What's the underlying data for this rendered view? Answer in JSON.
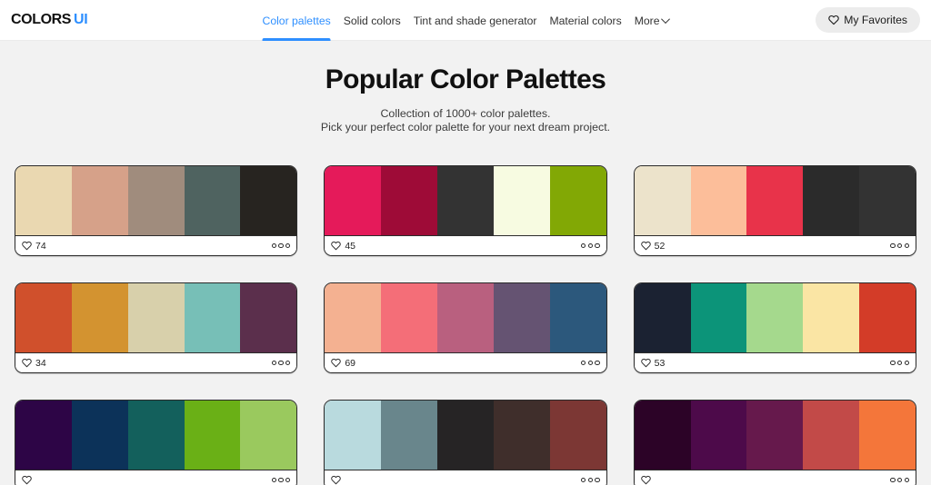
{
  "header": {
    "logo_primary": "COLORS",
    "logo_accent": "UI",
    "nav": [
      {
        "label": "Color palettes",
        "active": true
      },
      {
        "label": "Solid colors",
        "active": false
      },
      {
        "label": "Tint and shade generator",
        "active": false
      },
      {
        "label": "Material colors",
        "active": false
      },
      {
        "label": "More",
        "active": false,
        "has_chevron": true
      }
    ],
    "favorites_label": "My Favorites",
    "favorites_icon": "heart-outline-icon",
    "accent_color": "#2e8fff"
  },
  "hero": {
    "title": "Popular Color Palettes",
    "subtitle_line1": "Collection of 1000+ color palettes.",
    "subtitle_line2": "Pick your perfect color palette for your next dream project."
  },
  "card_icons": {
    "like_icon": "heart-outline-icon",
    "more_icon": "three-circles-icon"
  },
  "palettes": [
    {
      "likes": "74",
      "colors": [
        "#ead8b1",
        "#d6a189",
        "#a08c7d",
        "#4f6360",
        "#272420"
      ]
    },
    {
      "likes": "45",
      "colors": [
        "#e51a5a",
        "#9e0b37",
        "#333333",
        "#f7fbe1",
        "#82a805"
      ]
    },
    {
      "likes": "52",
      "colors": [
        "#ece3cb",
        "#fcbe9a",
        "#e8334a",
        "#2b2b2b",
        "#333333"
      ]
    },
    {
      "likes": "34",
      "colors": [
        "#d0502c",
        "#d39330",
        "#d8d0ab",
        "#77bfb7",
        "#5b2f4c"
      ]
    },
    {
      "likes": "69",
      "colors": [
        "#f4b191",
        "#f46e78",
        "#b9607f",
        "#655372",
        "#2c587c"
      ]
    },
    {
      "likes": "53",
      "colors": [
        "#1b2232",
        "#0c9479",
        "#a5d98d",
        "#fae5a4",
        "#d33c28"
      ]
    },
    {
      "likes": "",
      "colors": [
        "#2d0546",
        "#0c3259",
        "#13605c",
        "#6ab016",
        "#9ac95e"
      ]
    },
    {
      "likes": "",
      "colors": [
        "#b9dade",
        "#69868c",
        "#262425",
        "#3f2e2b",
        "#7c3734"
      ]
    },
    {
      "likes": "",
      "colors": [
        "#2c0327",
        "#4d0a4a",
        "#66194c",
        "#c24a48",
        "#f4763a"
      ]
    }
  ]
}
